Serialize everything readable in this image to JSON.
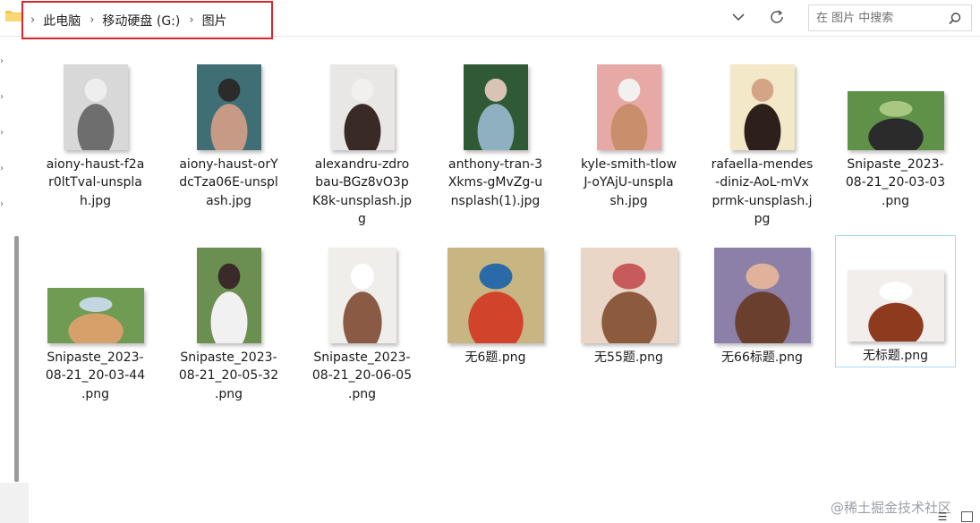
{
  "breadcrumb": [
    "此电脑",
    "移动硬盘 (G:)",
    "图片"
  ],
  "search": {
    "placeholder": "在 图片 中搜索"
  },
  "files": [
    {
      "name": "aiony-haust-f2ar0ltTval-unsplash.jpg",
      "label_lines": [
        "aiony-haust-f2a",
        "r0ltTval-unspla",
        "h.jpg"
      ],
      "thumb": "portrait-woman-bw",
      "colors": [
        "#d8d8d8",
        "#6e6e6e",
        "#eeeeee"
      ]
    },
    {
      "name": "aiony-haust-orYdcTza06E-unsplash.jpg",
      "label_lines": [
        "aiony-haust-orY",
        "dcTza06E-unspl",
        "ash.jpg"
      ],
      "thumb": "portrait-woman-teal",
      "colors": [
        "#3f6e75",
        "#c79a86",
        "#2b2b2b"
      ]
    },
    {
      "name": "alexandru-zdrobau-BGz8vO3pK8k-unsplash.jpg",
      "label_lines": [
        "alexandru-zdro",
        "bau-BGz8vO3p",
        "K8k-unsplash.jp",
        "g"
      ],
      "thumb": "portrait-woman-dark-hair",
      "colors": [
        "#e9e6e6",
        "#3a2a27",
        "#f2f0ee"
      ]
    },
    {
      "name": "anthony-tran-3Xkms-gMvZg-unsplash(1).jpg",
      "label_lines": [
        "anthony-tran-3",
        "Xkms-gMvZg-u",
        "nsplash(1).jpg"
      ],
      "thumb": "portrait-woman-green",
      "colors": [
        "#2f5a35",
        "#8fb0c0",
        "#d9c3b4"
      ]
    },
    {
      "name": "kyle-smith-tlowJ-oYAjU-unsplash.jpg",
      "label_lines": [
        "kyle-smith-tlow",
        "J-oYAjU-unspla",
        "sh.jpg"
      ],
      "thumb": "portrait-woman-pink",
      "colors": [
        "#e7a9a5",
        "#c98f6c",
        "#f3f1ef"
      ]
    },
    {
      "name": "rafaella-mendes-diniz-AoL-mVxprmk-unsplash.jpg",
      "label_lines": [
        "rafaella-mendes",
        "-diniz-AoL-mVx",
        "prmk-unsplash.j",
        "pg"
      ],
      "thumb": "portrait-woman-cream",
      "colors": [
        "#f3e8c8",
        "#2d1f19",
        "#d4a486"
      ]
    },
    {
      "name": "Snipaste_2023-08-21_20-03-03.png",
      "label_lines": [
        "Snipaste_2023-",
        "08-21_20-03-03",
        ".png"
      ],
      "thumb": "dog-on-grass",
      "colors": [
        "#5f9148",
        "#2b2b2b",
        "#a8c880"
      ]
    },
    {
      "name": "Snipaste_2023-08-21_20-03-44.png",
      "label_lines": [
        "Snipaste_2023-",
        "08-21_20-03-44",
        ".png"
      ],
      "thumb": "corgi-path",
      "colors": [
        "#6f9b53",
        "#d6a06b",
        "#c3d7e0"
      ]
    },
    {
      "name": "Snipaste_2023-08-21_20-05-32.png",
      "label_lines": [
        "Snipaste_2023-",
        "08-21_20-05-32",
        ".png"
      ],
      "thumb": "girl-backpack",
      "colors": [
        "#6b8f50",
        "#f1f1f1",
        "#3a2a2a"
      ]
    },
    {
      "name": "Snipaste_2023-08-21_20-06-05.png",
      "label_lines": [
        "Snipaste_2023-",
        "08-21_20-06-05",
        ".png"
      ],
      "thumb": "woman-white-curtain",
      "colors": [
        "#f0eeeb",
        "#8a5a45",
        "#ffffff"
      ]
    },
    {
      "name": "无6题.png",
      "label_lines": [
        "无6题.png"
      ],
      "thumb": "parrot",
      "colors": [
        "#c8b682",
        "#d2432c",
        "#2b6aa8"
      ]
    },
    {
      "name": "无55题.png",
      "label_lines": [
        "无55题.png"
      ],
      "thumb": "painted-woman",
      "colors": [
        "#e9d6c7",
        "#8c5a3c",
        "#c75a5a"
      ]
    },
    {
      "name": "无66标题.png",
      "label_lines": [
        "无66标题.png"
      ],
      "thumb": "painted-woman-flowers",
      "colors": [
        "#8c7fa8",
        "#6a3f2e",
        "#e0b29b"
      ]
    },
    {
      "name": "无标题.png",
      "label_lines": [
        "无标题.png"
      ],
      "thumb": "cavalier-dog",
      "colors": [
        "#f2eeeb",
        "#8e3a1f",
        "#ffffff"
      ],
      "selected": true
    }
  ],
  "watermark": "@稀土掘金技术社区"
}
